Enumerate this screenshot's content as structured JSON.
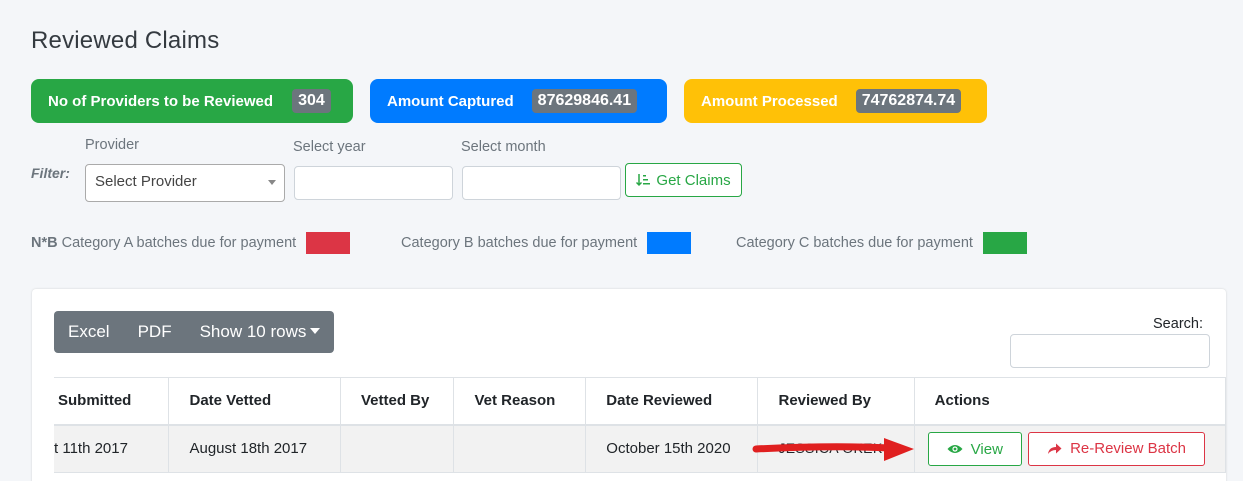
{
  "page": {
    "title": "Reviewed Claims"
  },
  "stats": [
    {
      "label": "No of Providers to be Reviewed",
      "value": "304",
      "color": "#28a745"
    },
    {
      "label": "Amount Captured",
      "value": "87629846.41",
      "color": "#007bff"
    },
    {
      "label": "Amount Processed",
      "value": "74762874.74",
      "color": "#ffc107"
    }
  ],
  "filter": {
    "label": "Filter:",
    "provider_label": "Provider",
    "provider_value": "Select Provider",
    "year_label": "Select year",
    "month_label": "Select month",
    "get_claims_label": "Get Claims"
  },
  "legend": {
    "prefix": "N*B",
    "items": [
      {
        "label": "Category A batches due for payment",
        "color": "#dc3545"
      },
      {
        "label": "Category B batches due for payment",
        "color": "#007bff"
      },
      {
        "label": "Category C batches due for payment",
        "color": "#28a745"
      }
    ]
  },
  "toolbar": {
    "excel": "Excel",
    "pdf": "PDF",
    "show_rows": "Show 10 rows",
    "search_label": "Search:"
  },
  "table": {
    "headers": [
      "Submitted",
      "Date Vetted",
      "Vetted By",
      "Vet Reason",
      "Date Reviewed",
      "Reviewed By",
      "Actions"
    ],
    "rows": [
      {
        "submitted": "t 11th 2017",
        "date_vetted": "August 18th 2017",
        "vetted_by": "",
        "vet_reason": "",
        "date_reviewed": "October 15th 2020",
        "reviewed_by": "JESSICA OKEKO",
        "view": "View",
        "rereview": "Re-Review Batch"
      }
    ]
  },
  "annotation_color": "#e02020"
}
